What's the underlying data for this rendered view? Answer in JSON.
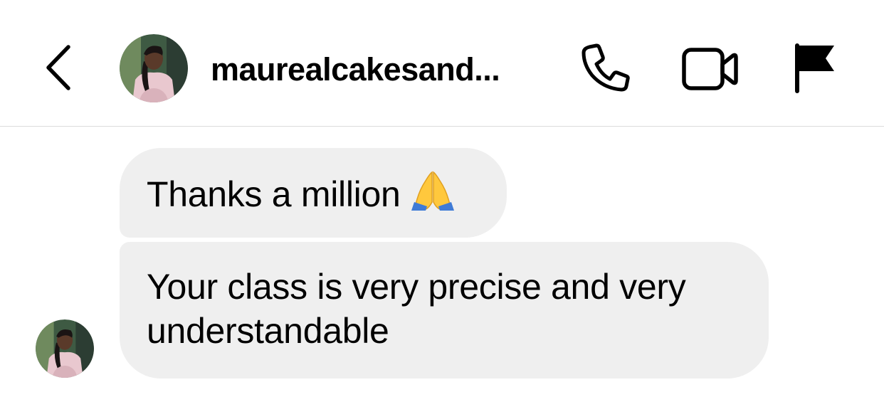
{
  "header": {
    "username": "maurealcakesand...",
    "icons": {
      "back": "chevron-left-icon",
      "call": "phone-icon",
      "video": "video-camera-icon",
      "report": "flag-icon"
    }
  },
  "messages": [
    {
      "text": "Thanks a million",
      "emoji": "folded-hands-emoji"
    },
    {
      "text": "Your class is very precise and very understandable"
    }
  ],
  "colors": {
    "bubble": "#efefef",
    "divider": "#dcdcdc",
    "text": "#000000"
  }
}
